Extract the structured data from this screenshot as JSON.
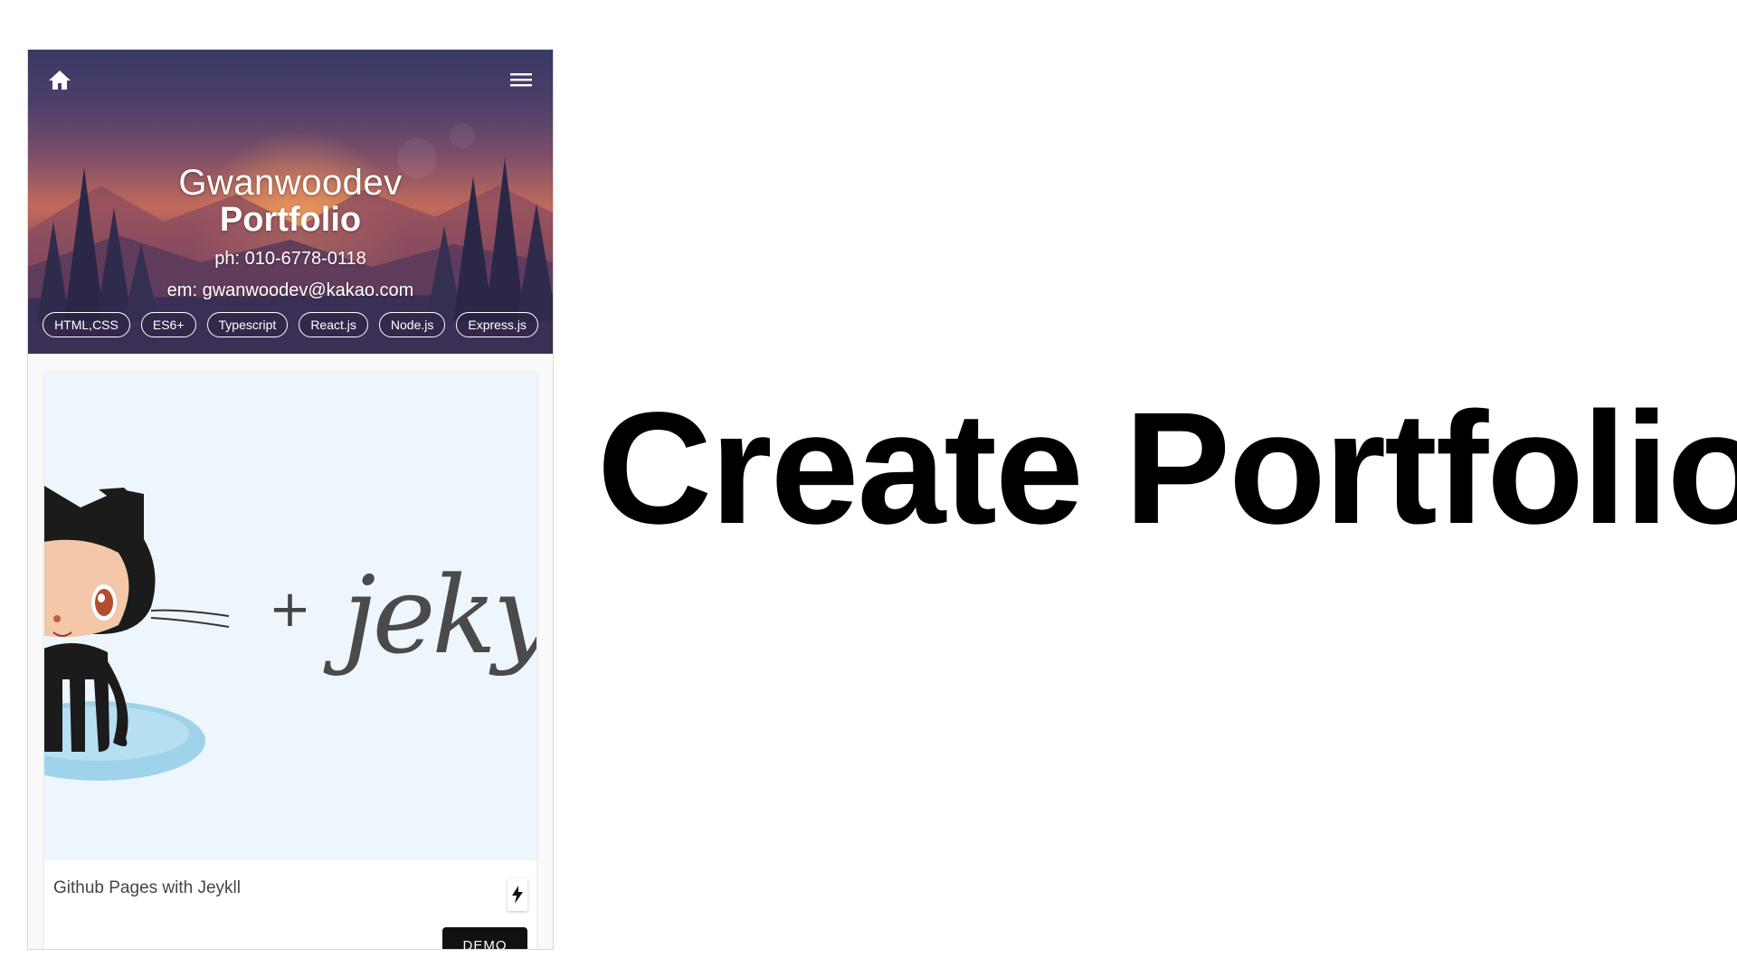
{
  "hero": {
    "name": "Gwanwoodev",
    "subtitle": "Portfolio",
    "phone": "ph: 010-6778-0118",
    "email": "em: gwanwoodev@kakao.com",
    "skills": [
      "HTML,CSS",
      "ES6+",
      "Typescript",
      "React.js",
      "Node.js",
      "Express.js"
    ]
  },
  "card": {
    "image_text": "jeky",
    "plus": "+",
    "title": "Github Pages with Jeykll",
    "demo_label": "DEMO"
  },
  "heading": "Create Portfolio",
  "icons": {
    "home": "home-icon",
    "menu": "hamburger-menu-icon",
    "bolt": "lightning-bolt-icon"
  },
  "colors": {
    "hero_top": "#373a63",
    "hero_sunset": "#c26a5a",
    "card_media_bg": "#eef6fd",
    "demo_button": "#111111"
  }
}
